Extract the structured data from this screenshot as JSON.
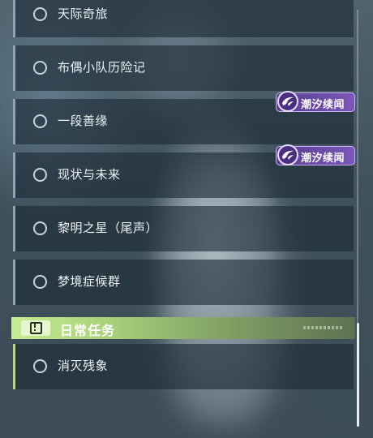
{
  "quests": [
    {
      "label": "天际奇旅"
    },
    {
      "label": "布偶小队历险记"
    },
    {
      "label": "一段善缘"
    },
    {
      "label": "现状与未来"
    },
    {
      "label": "黎明之星（尾声）"
    },
    {
      "label": "梦境症候群"
    }
  ],
  "tags": [
    {
      "label": "潮汐续闻",
      "icon": "tide-icon"
    },
    {
      "label": "潮汐续闻",
      "icon": "tide-icon"
    }
  ],
  "daily_section": {
    "title": "日常任务",
    "icon": "alert-icon",
    "items": [
      {
        "label": "消灭残象"
      }
    ]
  },
  "colors": {
    "quest_accent": "#8ea5b3",
    "daily_accent": "#b5d98b",
    "tag_purple": "#6b4aa8",
    "section_green": "#b5df85"
  }
}
